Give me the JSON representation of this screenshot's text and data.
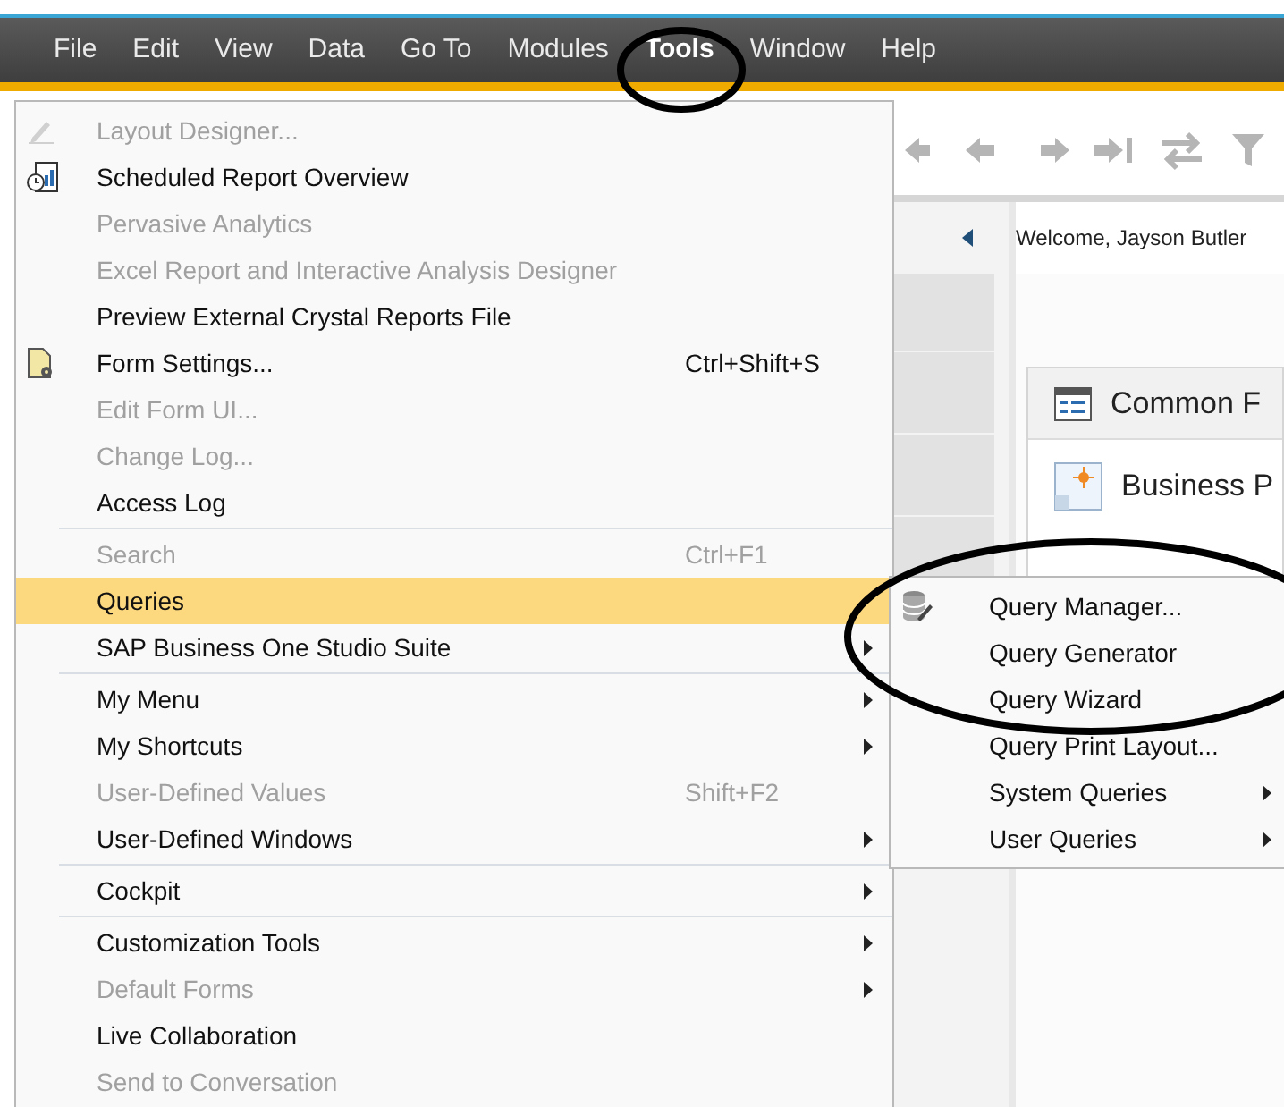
{
  "menubar": [
    {
      "label": "File",
      "selected": false
    },
    {
      "label": "Edit",
      "selected": false
    },
    {
      "label": "View",
      "selected": false
    },
    {
      "label": "Data",
      "selected": false
    },
    {
      "label": "Go To",
      "selected": false
    },
    {
      "label": "Modules",
      "selected": false
    },
    {
      "label": "Tools",
      "selected": true
    },
    {
      "label": "Window",
      "selected": false
    },
    {
      "label": "Help",
      "selected": false
    }
  ],
  "welcome": "Welcome, Jayson Butler",
  "card": {
    "title": "Common F",
    "items": [
      "Business P"
    ]
  },
  "tools_menu": [
    {
      "label": "Layout Designer...",
      "disabled": true,
      "selected": false
    },
    {
      "label": "Scheduled Report Overview",
      "disabled": false,
      "selected": false
    },
    {
      "label": "Pervasive Analytics",
      "disabled": true,
      "selected": false
    },
    {
      "label": "Excel Report and Interactive Analysis Designer",
      "disabled": true,
      "selected": false
    },
    {
      "label": "Preview External Crystal Reports File",
      "disabled": false,
      "selected": false
    },
    {
      "label": "Form Settings...",
      "disabled": false,
      "selected": false,
      "shortcut": "Ctrl+Shift+S"
    },
    {
      "label": "Edit Form UI...",
      "disabled": true,
      "selected": false
    },
    {
      "label": "Change Log...",
      "disabled": true,
      "selected": false
    },
    {
      "label": "Access Log",
      "disabled": false,
      "selected": false
    },
    {
      "label": "Search",
      "disabled": true,
      "selected": false,
      "group_start": true,
      "shortcut": "Ctrl+F1"
    },
    {
      "label": "Queries",
      "disabled": false,
      "selected": true
    },
    {
      "label": "SAP Business One Studio Suite",
      "disabled": false,
      "selected": false,
      "submenu": true
    },
    {
      "label": "My Menu",
      "disabled": false,
      "selected": false,
      "group_start": true,
      "submenu": true
    },
    {
      "label": "My Shortcuts",
      "disabled": false,
      "selected": false,
      "submenu": true
    },
    {
      "label": "User-Defined Values",
      "disabled": true,
      "selected": false,
      "shortcut": "Shift+F2"
    },
    {
      "label": "User-Defined Windows",
      "disabled": false,
      "selected": false,
      "submenu": true
    },
    {
      "label": "Cockpit",
      "disabled": false,
      "selected": false,
      "group_start": true,
      "submenu": true
    },
    {
      "label": "Customization Tools",
      "disabled": false,
      "selected": false,
      "group_start": true,
      "submenu": true
    },
    {
      "label": "Default Forms",
      "disabled": true,
      "selected": false,
      "submenu": true
    },
    {
      "label": "Live Collaboration",
      "disabled": false,
      "selected": false
    },
    {
      "label": "Send to Conversation",
      "disabled": true,
      "selected": false
    }
  ],
  "queries_menu": [
    {
      "label": "Query Manager..."
    },
    {
      "label": "Query Generator"
    },
    {
      "label": "Query Wizard"
    },
    {
      "label": "Query Print Layout..."
    },
    {
      "label": "System Queries",
      "submenu": true
    },
    {
      "label": "User Queries",
      "submenu": true
    }
  ]
}
